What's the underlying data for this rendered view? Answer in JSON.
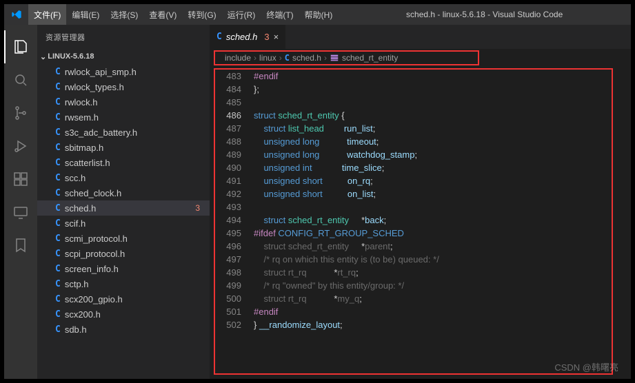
{
  "window": {
    "title": "sched.h - linux-5.6.18 - Visual Studio Code"
  },
  "menu": {
    "file": "文件(F)",
    "edit": "编辑(E)",
    "select": "选择(S)",
    "view": "查看(V)",
    "goto": "转到(G)",
    "run": "运行(R)",
    "terminal": "终端(T)",
    "help": "帮助(H)"
  },
  "sidebar": {
    "title": "资源管理器",
    "folder": "LINUX-5.6.18",
    "items": [
      {
        "label": "rwlock_api_smp.h"
      },
      {
        "label": "rwlock_types.h"
      },
      {
        "label": "rwlock.h"
      },
      {
        "label": "rwsem.h"
      },
      {
        "label": "s3c_adc_battery.h"
      },
      {
        "label": "sbitmap.h"
      },
      {
        "label": "scatterlist.h"
      },
      {
        "label": "scc.h"
      },
      {
        "label": "sched_clock.h"
      },
      {
        "label": "sched.h",
        "selected": true,
        "errors": "3"
      },
      {
        "label": "scif.h"
      },
      {
        "label": "scmi_protocol.h"
      },
      {
        "label": "scpi_protocol.h"
      },
      {
        "label": "screen_info.h"
      },
      {
        "label": "sctp.h"
      },
      {
        "label": "scx200_gpio.h"
      },
      {
        "label": "scx200.h"
      },
      {
        "label": "sdb.h"
      }
    ]
  },
  "tab": {
    "prefix": "C",
    "name": "sched.h",
    "errors": "3",
    "close": "×"
  },
  "breadcrumb": {
    "p1": "include",
    "p2": "linux",
    "p3prefix": "C",
    "p3": "sched.h",
    "p4": "sched_rt_entity",
    "sep": "›"
  },
  "code": {
    "start": 483,
    "lines": [
      {
        "n": 483,
        "seg": [
          {
            "c": "dir",
            "t": "#endif"
          }
        ]
      },
      {
        "n": 484,
        "seg": [
          {
            "c": "pun",
            "t": "};"
          }
        ]
      },
      {
        "n": 485,
        "seg": []
      },
      {
        "n": 486,
        "hi": true,
        "seg": [
          {
            "c": "kw",
            "t": "struct "
          },
          {
            "c": "typ",
            "t": "sched_rt_entity"
          },
          {
            "c": "pun",
            "t": " {"
          }
        ]
      },
      {
        "n": 487,
        "seg": [
          {
            "c": "pun",
            "t": "    "
          },
          {
            "c": "kw",
            "t": "struct "
          },
          {
            "c": "typ",
            "t": "list_head"
          },
          {
            "c": "pun",
            "t": "        "
          },
          {
            "c": "mem",
            "t": "run_list"
          },
          {
            "c": "pun",
            "t": ";"
          }
        ]
      },
      {
        "n": 488,
        "seg": [
          {
            "c": "pun",
            "t": "    "
          },
          {
            "c": "kw",
            "t": "unsigned long"
          },
          {
            "c": "pun",
            "t": "           "
          },
          {
            "c": "mem",
            "t": "timeout"
          },
          {
            "c": "pun",
            "t": ";"
          }
        ]
      },
      {
        "n": 489,
        "seg": [
          {
            "c": "pun",
            "t": "    "
          },
          {
            "c": "kw",
            "t": "unsigned long"
          },
          {
            "c": "pun",
            "t": "           "
          },
          {
            "c": "mem",
            "t": "watchdog_stamp"
          },
          {
            "c": "pun",
            "t": ";"
          }
        ]
      },
      {
        "n": 490,
        "seg": [
          {
            "c": "pun",
            "t": "    "
          },
          {
            "c": "kw",
            "t": "unsigned int"
          },
          {
            "c": "pun",
            "t": "            "
          },
          {
            "c": "mem",
            "t": "time_slice"
          },
          {
            "c": "pun",
            "t": ";"
          }
        ]
      },
      {
        "n": 491,
        "seg": [
          {
            "c": "pun",
            "t": "    "
          },
          {
            "c": "kw",
            "t": "unsigned short"
          },
          {
            "c": "pun",
            "t": "          "
          },
          {
            "c": "mem",
            "t": "on_rq"
          },
          {
            "c": "pun",
            "t": ";"
          }
        ]
      },
      {
        "n": 492,
        "seg": [
          {
            "c": "pun",
            "t": "    "
          },
          {
            "c": "kw",
            "t": "unsigned short"
          },
          {
            "c": "pun",
            "t": "          "
          },
          {
            "c": "mem",
            "t": "on_list"
          },
          {
            "c": "pun",
            "t": ";"
          }
        ]
      },
      {
        "n": 493,
        "seg": []
      },
      {
        "n": 494,
        "seg": [
          {
            "c": "pun",
            "t": "    "
          },
          {
            "c": "kw",
            "t": "struct "
          },
          {
            "c": "typ",
            "t": "sched_rt_entity"
          },
          {
            "c": "pun",
            "t": "     *"
          },
          {
            "c": "mem",
            "t": "back"
          },
          {
            "c": "pun",
            "t": ";"
          }
        ]
      },
      {
        "n": 495,
        "seg": [
          {
            "c": "dir",
            "t": "#ifdef "
          },
          {
            "c": "mac",
            "t": "CONFIG_RT_GROUP_SCHED"
          }
        ]
      },
      {
        "n": 496,
        "dim": true,
        "seg": [
          {
            "c": "pun",
            "t": "    "
          },
          {
            "c": "kw",
            "t": "struct "
          },
          {
            "c": "typ",
            "t": "sched_rt_entity"
          },
          {
            "c": "pun",
            "t": "     *"
          },
          {
            "c": "mem",
            "t": "parent"
          },
          {
            "c": "pun",
            "t": ";"
          }
        ]
      },
      {
        "n": 497,
        "dim": true,
        "seg": [
          {
            "c": "pun",
            "t": "    "
          },
          {
            "c": "cmt",
            "t": "/* rq on which this entity is (to be) queued: */"
          }
        ]
      },
      {
        "n": 498,
        "dim": true,
        "seg": [
          {
            "c": "pun",
            "t": "    "
          },
          {
            "c": "kw",
            "t": "struct "
          },
          {
            "c": "typ",
            "t": "rt_rq"
          },
          {
            "c": "pun",
            "t": "           *"
          },
          {
            "c": "mem",
            "t": "rt_rq"
          },
          {
            "c": "pun",
            "t": ";"
          }
        ]
      },
      {
        "n": 499,
        "dim": true,
        "seg": [
          {
            "c": "pun",
            "t": "    "
          },
          {
            "c": "cmt",
            "t": "/* rq \"owned\" by this entity/group: */"
          }
        ]
      },
      {
        "n": 500,
        "dim": true,
        "seg": [
          {
            "c": "pun",
            "t": "    "
          },
          {
            "c": "kw",
            "t": "struct "
          },
          {
            "c": "typ",
            "t": "rt_rq"
          },
          {
            "c": "pun",
            "t": "           *"
          },
          {
            "c": "mem",
            "t": "my_q"
          },
          {
            "c": "pun",
            "t": ";"
          }
        ]
      },
      {
        "n": 501,
        "seg": [
          {
            "c": "dir",
            "t": "#endif"
          }
        ]
      },
      {
        "n": 502,
        "seg": [
          {
            "c": "pun",
            "t": "} "
          },
          {
            "c": "mem",
            "t": "__randomize_layout"
          },
          {
            "c": "pun",
            "t": ";"
          }
        ]
      }
    ]
  },
  "watermark": "CSDN @韩曙亮"
}
